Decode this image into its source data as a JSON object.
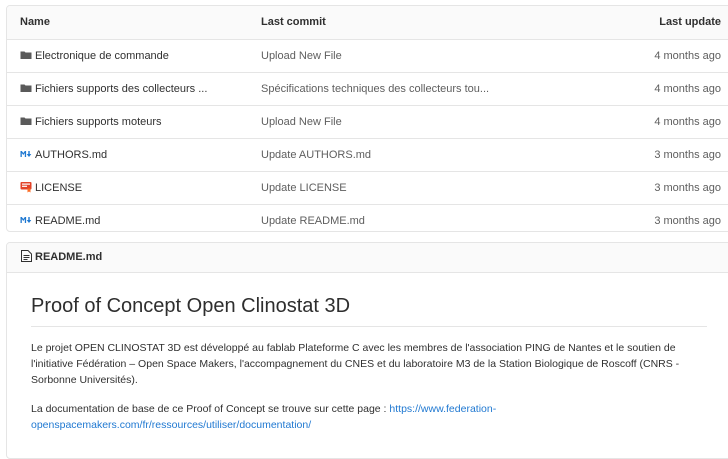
{
  "table": {
    "headers": {
      "name": "Name",
      "commit": "Last commit",
      "update": "Last update"
    },
    "rows": [
      {
        "icon": "folder-icon",
        "name": "Electronique de commande",
        "commit": "Upload New File",
        "update": "4 months ago"
      },
      {
        "icon": "folder-icon",
        "name": "Fichiers supports des collecteurs ...",
        "commit": "Spécifications techniques des collecteurs tou...",
        "update": "4 months ago"
      },
      {
        "icon": "folder-icon",
        "name": "Fichiers supports moteurs",
        "commit": "Upload New File",
        "update": "4 months ago"
      },
      {
        "icon": "markdown-icon",
        "name": "AUTHORS.md",
        "commit": "Update AUTHORS.md",
        "update": "3 months ago"
      },
      {
        "icon": "license-icon",
        "name": "LICENSE",
        "commit": "Update LICENSE",
        "update": "3 months ago"
      },
      {
        "icon": "markdown-icon",
        "name": "README.md",
        "commit": "Update README.md",
        "update": "3 months ago"
      }
    ]
  },
  "readme": {
    "file_label": "README.md",
    "title": "Proof of Concept Open Clinostat 3D",
    "paragraph1": "Le projet OPEN CLINOSTAT 3D est développé au fablab Plateforme C avec les membres de l'association PING de Nantes et le soutien de l'initiative Fédération – Open Space Makers, l'accompagnement du CNES et du laboratoire M3 de la Station Biologique de Roscoff (CNRS - Sorbonne Universités).",
    "paragraph2_prefix": "La documentation de base de ce Proof of Concept se trouve sur cette page : ",
    "paragraph2_link": "https://www.federation-openspacemakers.com/fr/ressources/utiliser/documentation/"
  },
  "colors": {
    "link": "#1f78d1",
    "markdown_icon": "#1f78d1",
    "license_icon": "#e24329",
    "folder_icon": "#5a5a5a"
  }
}
